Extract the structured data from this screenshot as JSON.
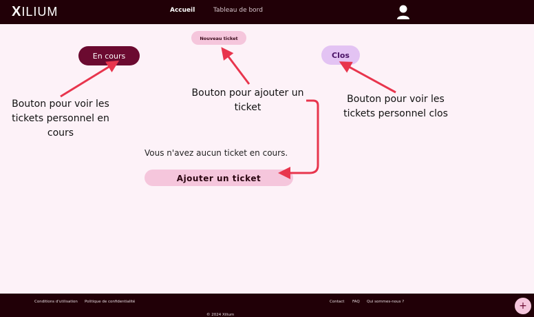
{
  "header": {
    "logo_text": "ILIUM",
    "logo_mark": "X",
    "nav": [
      {
        "label": "Accueil",
        "active": true
      },
      {
        "label": "Tableau de bord",
        "active": false
      }
    ],
    "user_icon": "user-icon"
  },
  "main": {
    "new_ticket_label": "Nouveau ticket",
    "en_cours_label": "En cours",
    "clos_label": "Clos",
    "empty_text": "Vous n'avez aucun ticket en cours.",
    "add_ticket_label": "Ajouter un ticket"
  },
  "annotations": {
    "en_cours": [
      "Bouton pour voir les",
      "tickets personnel en",
      "cours"
    ],
    "new_ticket": [
      "Bouton pour ajouter un",
      "ticket"
    ],
    "clos": [
      "Bouton pour voir les",
      "tickets personnel clos"
    ],
    "arrow_color": "#e8354d"
  },
  "footer": {
    "left_links": [
      "Conditions d'utilisation",
      "Politique de confidentialité"
    ],
    "right_links": [
      "Contact",
      "FAQ",
      "Qui sommes-nous ?"
    ],
    "copyright": "© 2024 Xilium",
    "fab_label": "+"
  },
  "colors": {
    "header_bg": "#210007",
    "page_bg": "#fdf2f8",
    "primary": "#6b0a30",
    "pink": "#f5c6dc",
    "lavender": "#e3c3f3"
  }
}
